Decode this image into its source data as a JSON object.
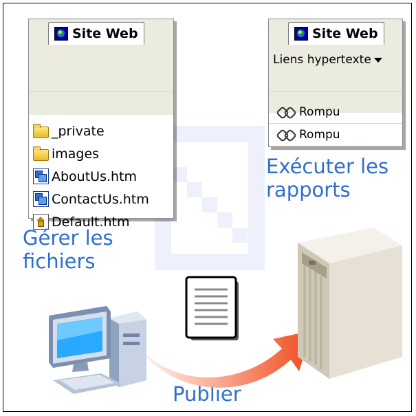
{
  "files_panel": {
    "tab_label": "Site Web",
    "items": [
      {
        "name": "_private",
        "icon": "folder-icon"
      },
      {
        "name": "images",
        "icon": "folder-icon"
      },
      {
        "name": "AboutUs.htm",
        "icon": "web-page-icon"
      },
      {
        "name": "ContactUs.htm",
        "icon": "web-page-icon"
      },
      {
        "name": "Default.htm",
        "icon": "home-page-icon"
      }
    ]
  },
  "reports_panel": {
    "tab_label": "Site Web",
    "view_select": "Liens hypertexte",
    "rows": [
      {
        "status": "Rompu",
        "icon": "broken-link-icon"
      },
      {
        "status": "Rompu",
        "icon": "broken-link-icon"
      }
    ]
  },
  "captions": {
    "manage_files_line1": "Gérer les",
    "manage_files_line2": "fichiers",
    "run_reports_line1": "Exécuter les",
    "run_reports_line2": "rapports",
    "publish": "Publier"
  },
  "colors": {
    "caption_blue": "#2f6ed1",
    "arrow_red": "#f04a1c",
    "panel_band": "#ecebe0"
  }
}
